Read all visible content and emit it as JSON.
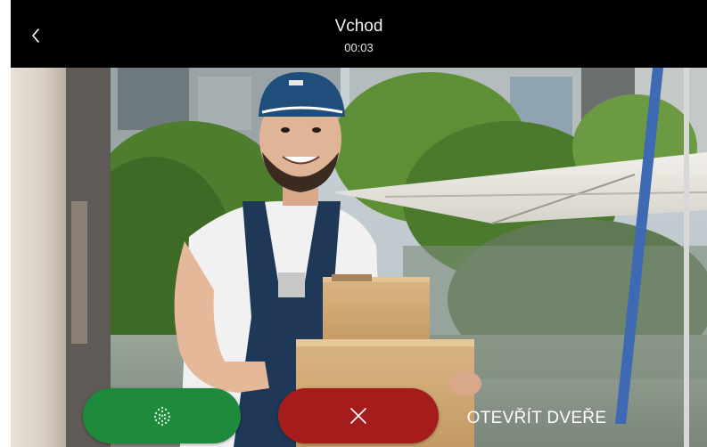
{
  "header": {
    "title": "Vchod",
    "timer": "00:03",
    "back_icon": "chevron-left-icon"
  },
  "actions": {
    "microphone_icon": "microphone-grille-icon",
    "microphone_color": "#1e8a3c",
    "hangup_icon": "close-icon",
    "hangup_color": "#a51c1a",
    "open_door_label": "OTEVŘÍT DVEŘE"
  },
  "video": {
    "description_icon": "camera-feed-image"
  }
}
